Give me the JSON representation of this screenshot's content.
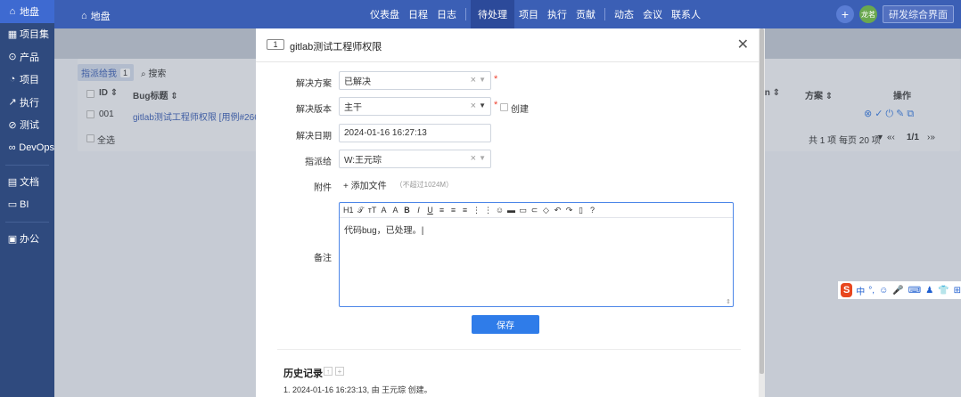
{
  "sidebar": {
    "items": [
      {
        "label": "地盘",
        "icon": "home-icon",
        "glyph": "⌂",
        "active": true
      },
      {
        "label": "项目集",
        "icon": "grid-icon",
        "glyph": "▦"
      },
      {
        "label": "产品",
        "icon": "location-icon",
        "glyph": "⊙"
      },
      {
        "label": "项目",
        "icon": "bulb-icon",
        "glyph": "◔"
      },
      {
        "label": "执行",
        "icon": "run-icon",
        "glyph": "↗"
      },
      {
        "label": "测试",
        "icon": "search-icon",
        "glyph": "⊘"
      },
      {
        "label": "DevOps",
        "icon": "infinity-icon",
        "glyph": "∞"
      }
    ],
    "items2": [
      {
        "label": "文档",
        "icon": "document-icon",
        "glyph": "▤"
      },
      {
        "label": "BI",
        "icon": "chart-icon",
        "glyph": "▭"
      }
    ],
    "items3": [
      {
        "label": "办公",
        "icon": "office-icon",
        "glyph": "▣"
      }
    ]
  },
  "topbar": {
    "home_label": "地盘",
    "nav": [
      "仪表盘",
      "日程",
      "日志",
      "待处理",
      "项目",
      "执行",
      "贡献",
      "动态",
      "会议",
      "联系人"
    ],
    "avatar_text": "龙茗",
    "switch_btn": "研发综合界面"
  },
  "list": {
    "tab_label": "指派给我",
    "tab_count": "1",
    "search_label": "搜索",
    "col_id": "ID",
    "col_title": "Bug标题",
    "col_plan": "方案",
    "col_actions": "操作",
    "row_id": "001",
    "row_title": "gitlab测试工程师权限 [用例#266]",
    "select_all": "全选",
    "pager_total": "共 1 项",
    "pager_per": "每页 20 项",
    "pager_pages": "1/1"
  },
  "modal": {
    "id": "1",
    "title": "gitlab测试工程师权限",
    "fields": {
      "resolution_label": "解决方案",
      "resolution_value": "已解决",
      "build_label": "解决版本",
      "build_value": "主干",
      "create_label": "创建",
      "date_label": "解决日期",
      "date_value": "2024-01-16 16:27:13",
      "assign_label": "指派给",
      "assign_value": "W:王元琮",
      "attach_label": "附件",
      "attach_btn": "添加文件",
      "attach_hint": "（不超过1024M）",
      "comment_label": "备注"
    },
    "editor": {
      "toolbar": [
        "H1",
        "𝒯",
        "тT",
        "A",
        "A",
        "B",
        "I",
        "U",
        "≡",
        "≡",
        "≡",
        "⋮",
        "⋮",
        "☺",
        "▬",
        "▭",
        "⊂",
        "◇",
        "↶",
        "↷",
        "▯",
        "?"
      ],
      "content": "代码bug，已处理。"
    },
    "save_label": "保存",
    "history_title": "历史记录",
    "history_item": "1. 2024-01-16 16:23:13, 由 王元琮 创建。"
  },
  "ime": {
    "label": "中",
    "items": [
      "°,",
      "☺",
      "🎤",
      "⌨",
      "♟",
      "👕",
      "⊞"
    ]
  },
  "colors": {
    "sidebar": "#2f4a7e",
    "topbar": "#3b5fb5",
    "primary": "#2f7ce9",
    "required": "#ee4433"
  }
}
